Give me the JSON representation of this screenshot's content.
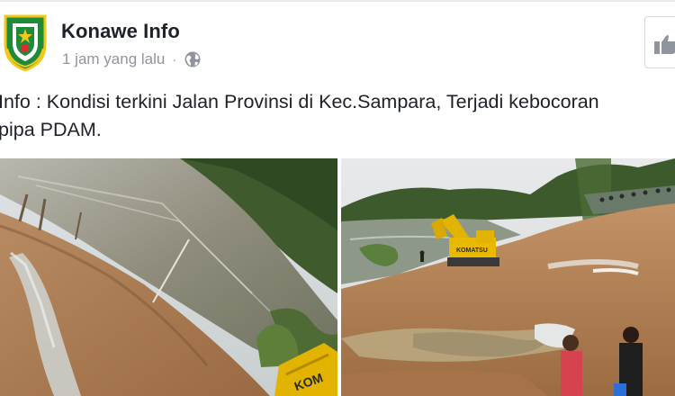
{
  "post": {
    "page_name": "Konawe Info",
    "timestamp": "1 jam yang lalu",
    "separator": "·",
    "audience_icon": "globe-icon",
    "text": "Info : Kondisi terkini Jalan Provinsi di Kec.Sampara, Terjadi kebocoran\npipa PDAM.",
    "like_icon": "thumbs-up-icon"
  },
  "colors": {
    "page_name": "#1d2129",
    "meta": "#90949c",
    "avatar_green": "#1f8a3a",
    "avatar_yellow": "#f2c81b"
  },
  "photos": [
    {
      "name": "flooded-riverbank-photo",
      "icons": [
        "excavator-icon"
      ]
    },
    {
      "name": "excavator-repair-site-photo",
      "icons": [
        "excavator-icon",
        "person-icon"
      ]
    }
  ]
}
